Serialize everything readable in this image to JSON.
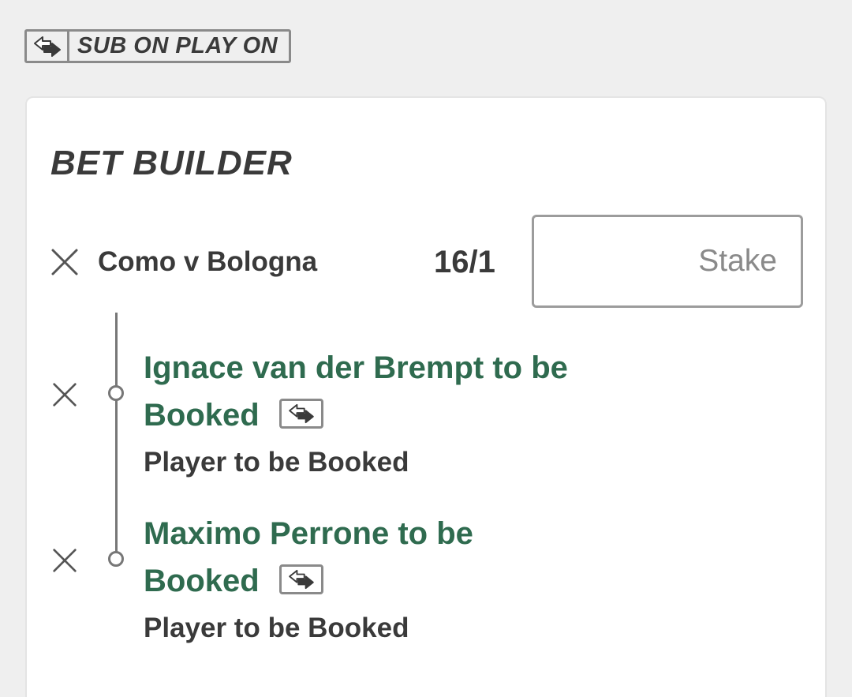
{
  "sopo_badge": {
    "label": "SUB ON PLAY ON",
    "icon": "swap-arrows-icon"
  },
  "bet_builder": {
    "title": "BET BUILDER",
    "event": {
      "name": "Como v Bologna",
      "odds": "16/1"
    },
    "stake": {
      "placeholder": "Stake",
      "value": ""
    },
    "selections": [
      {
        "name": "Ignace van der Brempt to be Booked",
        "market": "Player to be Booked",
        "sopo_icon": "swap-arrows-icon"
      },
      {
        "name": "Maximo Perrone to be Booked",
        "market": "Player to be Booked",
        "sopo_icon": "swap-arrows-icon"
      }
    ]
  },
  "colors": {
    "background": "#efefef",
    "card": "#ffffff",
    "selection_text": "#2f6b4f",
    "primary_text": "#3a3a3a",
    "border": "#8a8a8a"
  }
}
